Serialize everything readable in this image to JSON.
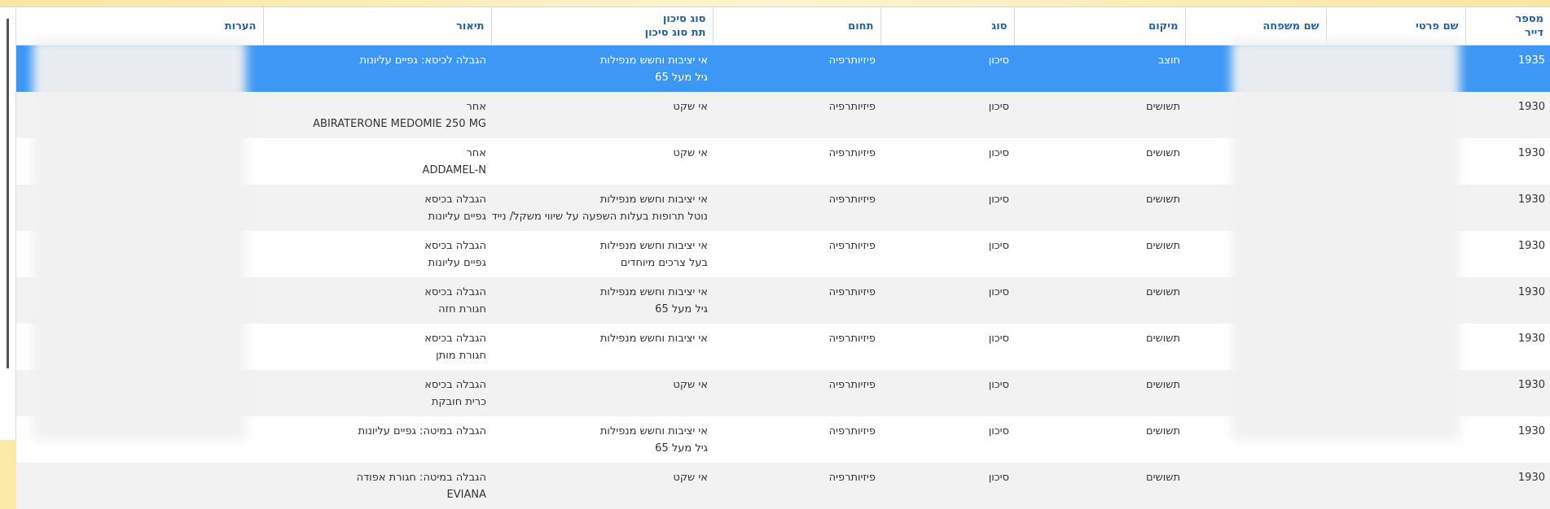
{
  "columns": {
    "id_line1": "מספר",
    "id_line2": "דייר",
    "first_name": "שם פרטי",
    "last_name": "שם משפחה",
    "location": "מיקום",
    "type": "סוג",
    "domain": "תחום",
    "risk_line1": "סוג סיכון",
    "risk_line2": "תת סוג סיכון",
    "description": "תיאור",
    "notes": "הערות"
  },
  "rows": [
    {
      "id": "1935",
      "location": "חוצב",
      "type": "סיכון",
      "domain": "פיזיותרפיה",
      "risk1": "אי יציבות וחשש מנפילות",
      "risk2": "גיל מעל 65",
      "desc1": "הגבלה לכיסא: גפיים עליונות",
      "desc2": ""
    },
    {
      "id": "1930",
      "location": "תשושים",
      "type": "סיכון",
      "domain": "פיזיותרפיה",
      "risk1": "אי שקט",
      "risk2": "",
      "desc1": "אחר",
      "desc2": "ABIRATERONE MEDOMIE 250 MG"
    },
    {
      "id": "1930",
      "location": "תשושים",
      "type": "סיכון",
      "domain": "פיזיותרפיה",
      "risk1": "אי שקט",
      "risk2": "",
      "desc1": "אחר",
      "desc2": "ADDAMEL-N"
    },
    {
      "id": "1930",
      "location": "תשושים",
      "type": "סיכון",
      "domain": "פיזיותרפיה",
      "risk1": "אי יציבות וחשש מנפילות",
      "risk2": "נוטל תרופות בעלות השפעה על שיווי משקל/ ניידות ומ",
      "desc1": "הגבלה בכיסא",
      "desc2": "גפיים עליונות"
    },
    {
      "id": "1930",
      "location": "תשושים",
      "type": "סיכון",
      "domain": "פיזיותרפיה",
      "risk1": "אי יציבות וחשש מנפילות",
      "risk2": "בעל צרכים מיוחדים",
      "desc1": "הגבלה בכיסא",
      "desc2": "גפיים עליונות"
    },
    {
      "id": "1930",
      "location": "תשושים",
      "type": "סיכון",
      "domain": "פיזיותרפיה",
      "risk1": "אי יציבות וחשש מנפילות",
      "risk2": "גיל מעל 65",
      "desc1": "הגבלה בכיסא",
      "desc2": "חגורת חזה"
    },
    {
      "id": "1930",
      "location": "תשושים",
      "type": "סיכון",
      "domain": "פיזיותרפיה",
      "risk1": "אי יציבות וחשש מנפילות",
      "risk2": "",
      "desc1": "הגבלה בכיסא",
      "desc2": "חגורת מותן"
    },
    {
      "id": "1930",
      "location": "תשושים",
      "type": "סיכון",
      "domain": "פיזיותרפיה",
      "risk1": "אי שקט",
      "risk2": "",
      "desc1": "הגבלה בכיסא",
      "desc2": "כרית חובקת"
    },
    {
      "id": "1930",
      "location": "תשושים",
      "type": "סיכון",
      "domain": "פיזיותרפיה",
      "risk1": "אי יציבות וחשש מנפילות",
      "risk2": "גיל מעל 65",
      "desc1": "הגבלה במיטה: גפיים עליונות",
      "desc2": ""
    },
    {
      "id": "1930",
      "location": "תשושים",
      "type": "סיכון",
      "domain": "פיזיותרפיה",
      "risk1": "אי שקט",
      "risk2": "",
      "desc1": "הגבלה במיטה: חגורת אפודה",
      "desc2": "EVIANA"
    }
  ],
  "selected_row": 0,
  "colors": {
    "selected": "#3d97f4",
    "header_text": "#2a62a0"
  }
}
